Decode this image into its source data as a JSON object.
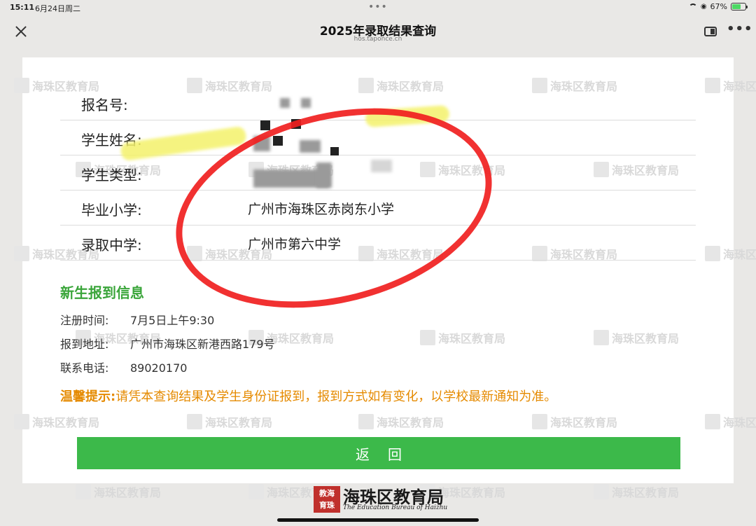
{
  "status_bar": {
    "time": "15:11",
    "date": "6月24日周二",
    "battery": "67%",
    "dots": "•••"
  },
  "nav": {
    "title": "2025年录取结果查询",
    "url": "hos.taponce.cn",
    "more": "•••"
  },
  "info_rows": [
    {
      "label": "报名号:",
      "value": ""
    },
    {
      "label": "学生姓名:",
      "value": ""
    },
    {
      "label": "学生类型:",
      "value": ""
    },
    {
      "label": "毕业小学:",
      "value": "广州市海珠区赤岗东小学"
    },
    {
      "label": "录取中学:",
      "value": "广州市第六中学"
    }
  ],
  "registration": {
    "title": "新生报到信息",
    "time_label": "注册时间:",
    "time_value": "7月5日上午9:30",
    "address_label": "报到地址:",
    "address_value": "广州市海珠区新港西路179号",
    "phone_label": "联系电话:",
    "phone_value": "89020170"
  },
  "tip": {
    "label": "温馨提示:",
    "text": "请凭本查询结果及学生身份证报到，报到方式如有变化，以学校最新通知为准。"
  },
  "return_button": "返回",
  "footer": {
    "seal": "教海育珠",
    "name": "海珠区教育局",
    "subtitle": "The Education Bureau of Haizhu"
  },
  "watermark": "海珠区教育局",
  "colors": {
    "accent_green": "#3cb94a",
    "section_green": "#3aa53a",
    "tip_orange": "#e58a00",
    "annotation_red": "#f02020"
  }
}
